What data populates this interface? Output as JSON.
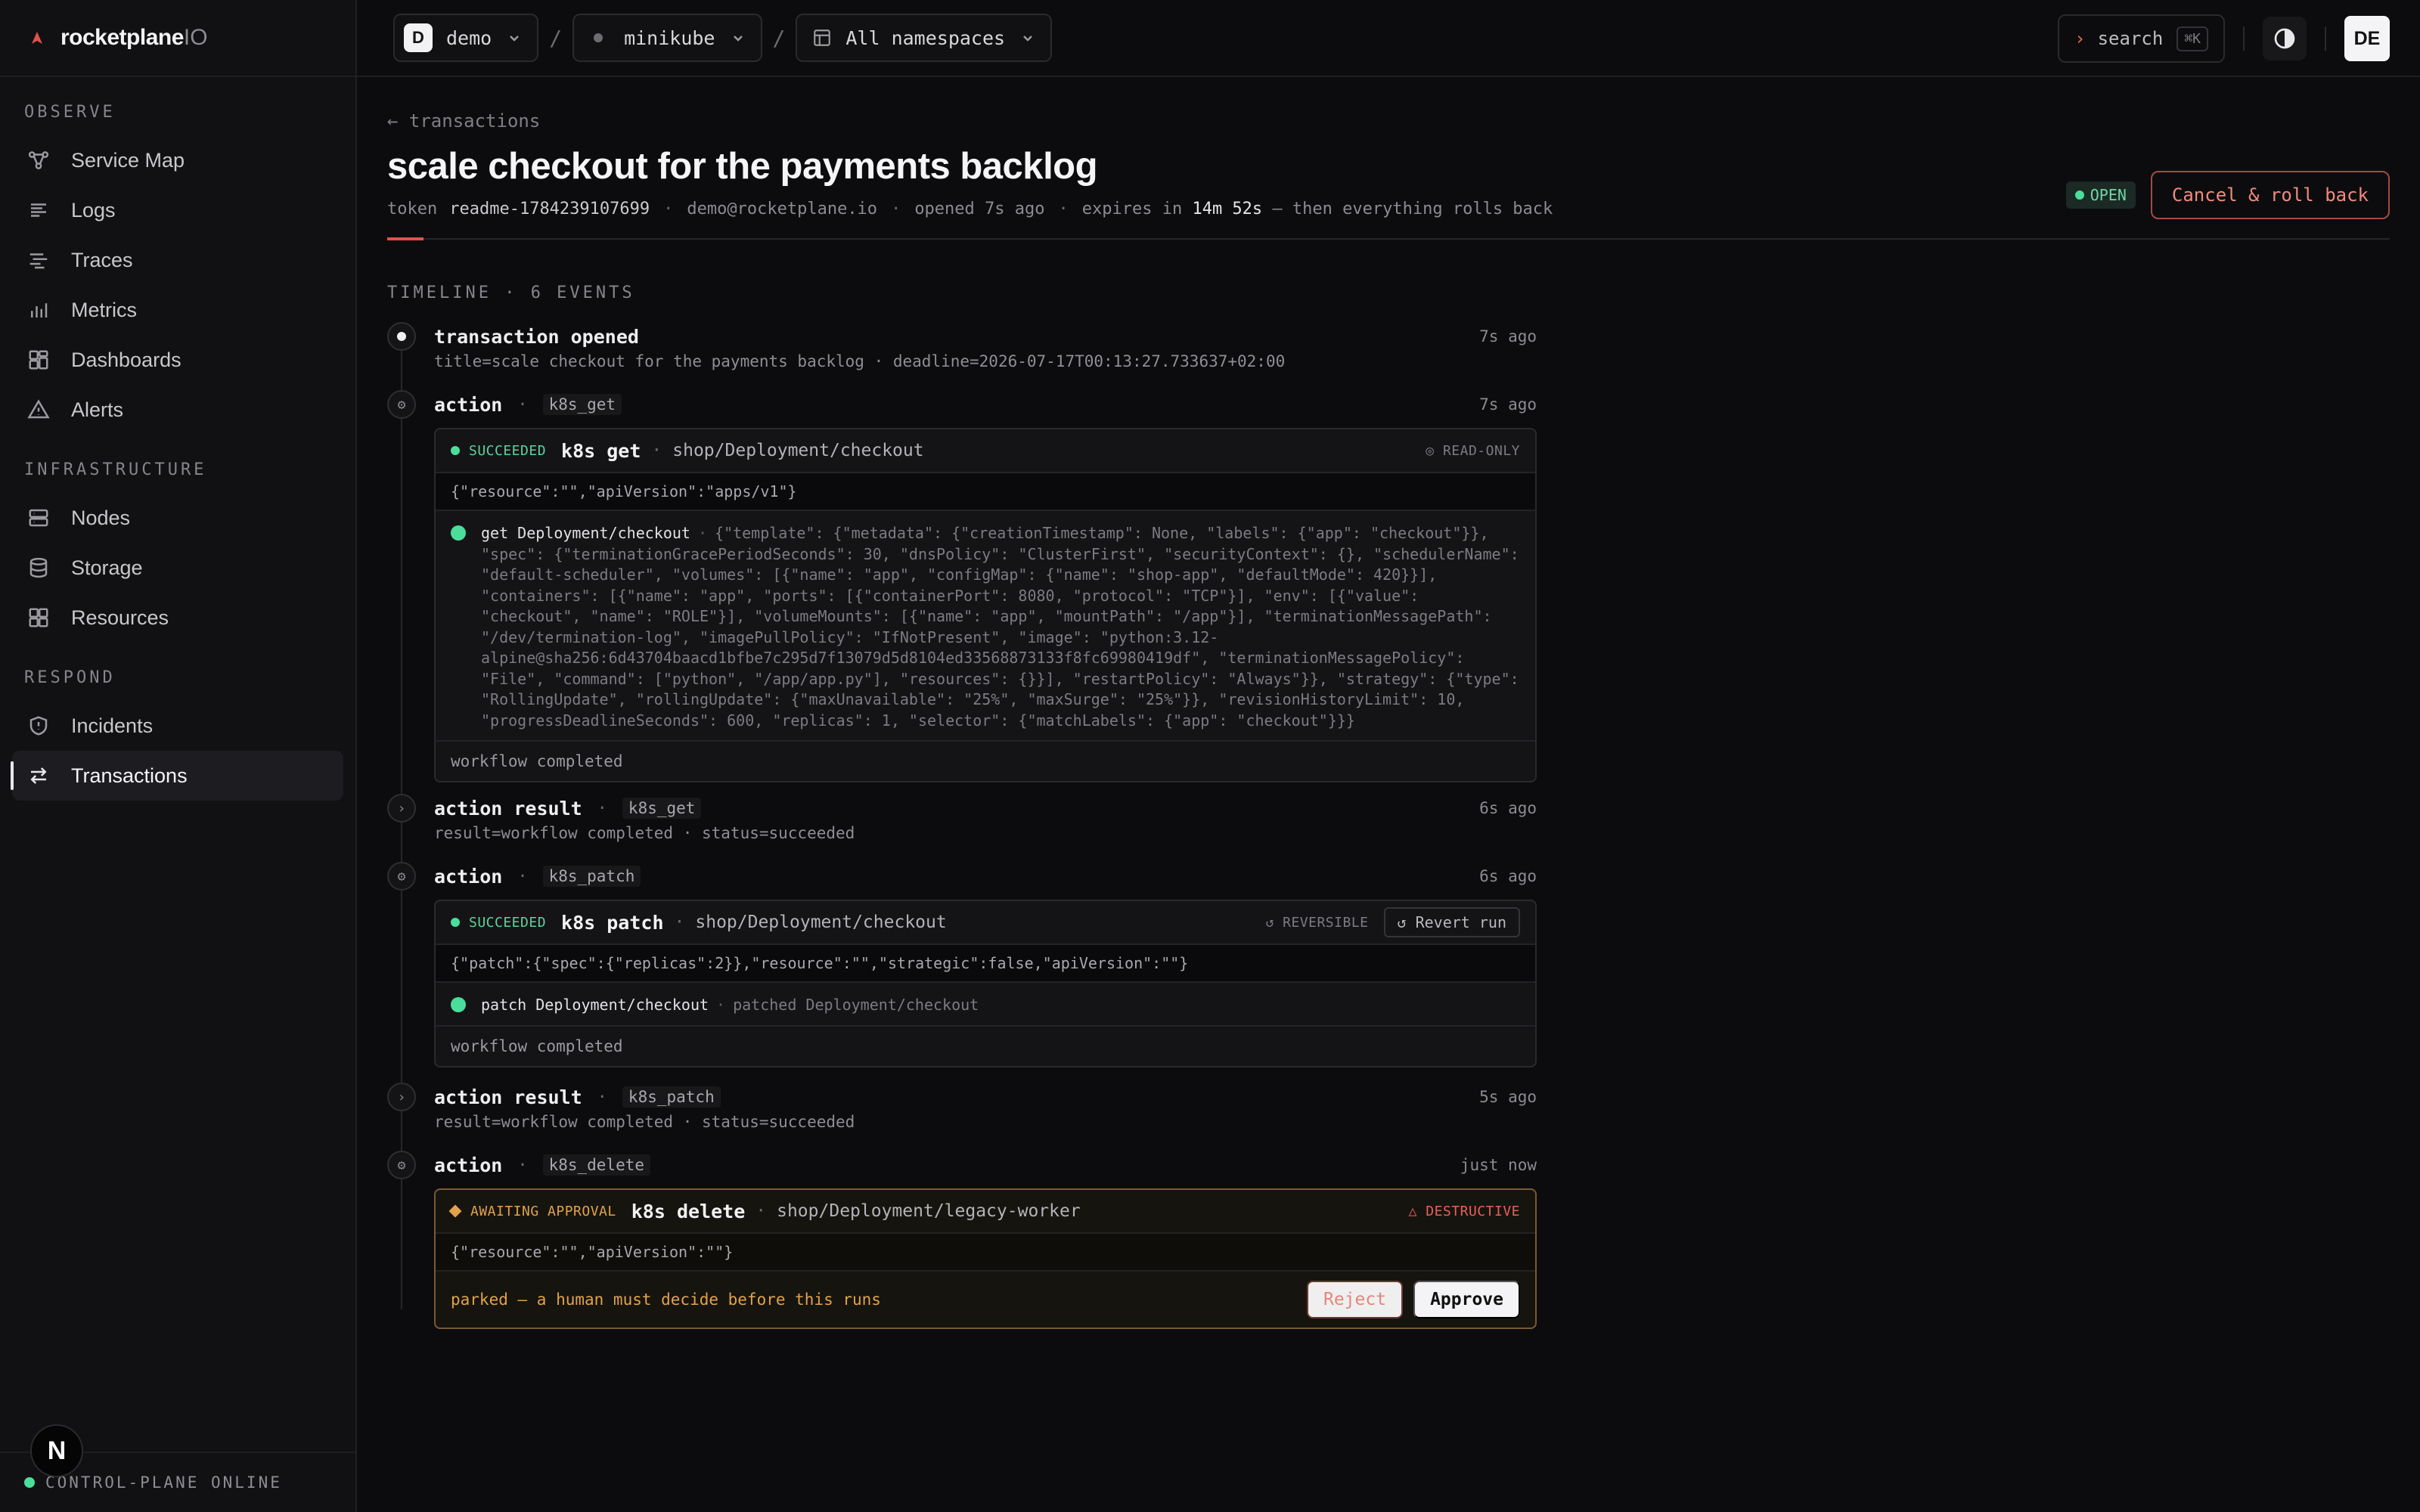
{
  "brand": {
    "name": "rocketplane",
    "suffix": "IO"
  },
  "sidebar": {
    "sections": [
      {
        "heading": "OBSERVE",
        "items": [
          "Service Map",
          "Logs",
          "Traces",
          "Metrics",
          "Dashboards",
          "Alerts"
        ]
      },
      {
        "heading": "INFRASTRUCTURE",
        "items": [
          "Nodes",
          "Storage",
          "Resources"
        ]
      },
      {
        "heading": "RESPOND",
        "items": [
          "Incidents",
          "Transactions"
        ]
      }
    ],
    "active": "Transactions",
    "status": "CONTROL-PLANE ONLINE",
    "badge": "N"
  },
  "topbar": {
    "env_initial": "D",
    "env": "demo",
    "cluster": "minikube",
    "namespace": "All namespaces",
    "separator": "/",
    "search_label": "search",
    "search_caret": "›",
    "search_kbd": "⌘K",
    "user_initials": "DE"
  },
  "page": {
    "back": "← transactions",
    "title": "scale checkout for the payments backlog",
    "token_label": "token",
    "token": "readme-1784239107699",
    "user": "demo@rocketplane.io",
    "opened": "opened 7s ago",
    "expires_prefix": "expires in",
    "expires_value": "14m 52s",
    "expires_suffix": "— then everything rolls back",
    "status": "OPEN",
    "cancel_label": "Cancel & roll back"
  },
  "timeline": {
    "heading": "TIMELINE · 6 EVENTS",
    "events": [
      {
        "kind": "transaction opened",
        "time": "7s ago",
        "sub": "title=scale checkout for the payments backlog · deadline=2026-07-17T00:13:27.733637+02:00"
      },
      {
        "kind": "action",
        "tool": "k8s_get",
        "time": "7s ago",
        "card": {
          "status": "SUCCEEDED",
          "op": "k8s get",
          "target": "shop/Deployment/checkout",
          "flag": "◎ READ-ONLY",
          "args": "{\"resource\":\"\",\"apiVersion\":\"apps/v1\"}",
          "step_name": "get Deployment/checkout",
          "step_detail": "{\"template\": {\"metadata\": {\"creationTimestamp\": None, \"labels\": {\"app\": \"checkout\"}}, \"spec\": {\"terminationGracePeriodSeconds\": 30, \"dnsPolicy\": \"ClusterFirst\", \"securityContext\": {}, \"schedulerName\": \"default-scheduler\", \"volumes\": [{\"name\": \"app\", \"configMap\": {\"name\": \"shop-app\", \"defaultMode\": 420}}], \"containers\": [{\"name\": \"app\", \"ports\": [{\"containerPort\": 8080, \"protocol\": \"TCP\"}], \"env\": [{\"value\": \"checkout\", \"name\": \"ROLE\"}], \"volumeMounts\": [{\"name\": \"app\", \"mountPath\": \"/app\"}], \"terminationMessagePath\": \"/dev/termination-log\", \"imagePullPolicy\": \"IfNotPresent\", \"image\": \"python:3.12-alpine@sha256:6d43704baacd1bfbe7c295d7f13079d5d8104ed33568873133f8fc69980419df\", \"terminationMessagePolicy\": \"File\", \"command\": [\"python\", \"/app/app.py\"], \"resources\": {}}], \"restartPolicy\": \"Always\"}}, \"strategy\": {\"type\": \"RollingUpdate\", \"rollingUpdate\": {\"maxUnavailable\": \"25%\", \"maxSurge\": \"25%\"}}, \"revisionHistoryLimit\": 10, \"progressDeadlineSeconds\": 600, \"replicas\": 1, \"selector\": {\"matchLabels\": {\"app\": \"checkout\"}}}",
          "footer": "workflow completed"
        }
      },
      {
        "kind": "action result",
        "tool": "k8s_get",
        "time": "6s ago",
        "sub": "result=workflow completed · status=succeeded"
      },
      {
        "kind": "action",
        "tool": "k8s_patch",
        "time": "6s ago",
        "card": {
          "status": "SUCCEEDED",
          "op": "k8s patch",
          "target": "shop/Deployment/checkout",
          "flag": "↺ REVERSIBLE",
          "revert_label": "↺ Revert run",
          "args": "{\"patch\":{\"spec\":{\"replicas\":2}},\"resource\":\"\",\"strategic\":false,\"apiVersion\":\"\"}",
          "step_name": "patch Deployment/checkout",
          "step_detail": "patched Deployment/checkout",
          "footer": "workflow completed"
        }
      },
      {
        "kind": "action result",
        "tool": "k8s_patch",
        "time": "5s ago",
        "sub": "result=workflow completed · status=succeeded"
      },
      {
        "kind": "action",
        "tool": "k8s_delete",
        "time": "just now",
        "card": {
          "status": "AWAITING APPROVAL",
          "op": "k8s delete",
          "target": "shop/Deployment/legacy-worker",
          "flag": "△ DESTRUCTIVE",
          "args": "{\"resource\":\"\",\"apiVersion\":\"\"}",
          "footer": "parked — a human must decide before this runs",
          "reject_label": "Reject",
          "approve_label": "Approve"
        }
      }
    ]
  },
  "colors": {
    "accent": "#e0524a",
    "success": "#4ade9b",
    "warning": "#e2a24b",
    "danger": "#e5625a"
  }
}
